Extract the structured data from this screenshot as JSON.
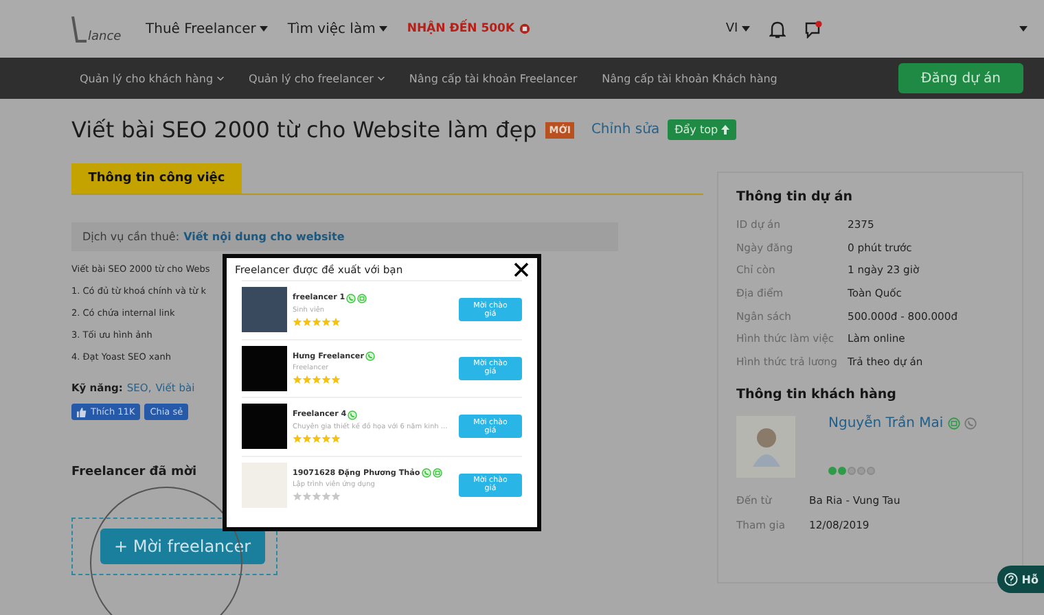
{
  "header": {
    "logo": "lance",
    "menu": [
      {
        "label": "Thuê Freelancer",
        "kind": "dropdown"
      },
      {
        "label": "Tìm việc làm",
        "kind": "dropdown"
      },
      {
        "label": "NHẬN ĐẾN 500K",
        "kind": "promo"
      }
    ],
    "language": "VI",
    "has_notification": true
  },
  "nav": {
    "items": [
      "Quản lý cho khách hàng",
      "Quản lý cho freelancer",
      "Nâng cấp tài khoản Freelancer",
      "Nâng cấp tài khoản Khách hàng"
    ],
    "dropdowns": [
      true,
      true,
      false,
      false
    ],
    "post_button": "Đăng dự án"
  },
  "project": {
    "title": "Viết bài SEO 2000 từ cho Website làm đẹp",
    "new_badge": "MỚI",
    "edit_link": "Chỉnh sửa",
    "top_button": "Đẩy top"
  },
  "tabs": [
    {
      "label": "Thông tin công việc",
      "selected": true
    }
  ],
  "service": {
    "label": "Dịch vụ cần thuê:",
    "value": "Viết nội dung cho website"
  },
  "description": [
    "Viết bài SEO 2000 từ cho Webs",
    "1. Có đủ từ khoá chính và từ k",
    "2. Có chứa internal link",
    "3. Tối ưu hình ảnh",
    "4. Đạt Yoast SEO xanh"
  ],
  "skills": {
    "label": "Kỹ năng:",
    "items": [
      "SEO,",
      "Viết bài"
    ]
  },
  "social": {
    "like": "Thích",
    "like_count": "11K",
    "share": "Chia sẻ"
  },
  "invited": {
    "title": "Freelancer đã mời",
    "button": "+ Mời freelancer"
  },
  "project_info": {
    "title": "Thông tin dự án",
    "rows": [
      {
        "label": "ID dự án",
        "value": "2375"
      },
      {
        "label": "Ngày đăng",
        "value": "0 phút trước"
      },
      {
        "label": "Chỉ còn",
        "value": "1 ngày 23 giờ"
      },
      {
        "label": "Địa điểm",
        "value": "Toàn Quốc"
      },
      {
        "label": "Ngân sách",
        "value": "500.000đ - 800.000đ"
      },
      {
        "label": "Hình thức làm việc",
        "value": "Làm online"
      },
      {
        "label": "Hình thức trả lương",
        "value": "Trả theo dự án"
      }
    ]
  },
  "client_info": {
    "title": "Thông tin khách hàng",
    "name": "Nguyễn Trần Mai",
    "id_verified": true,
    "phone_verified": false,
    "stars": 2,
    "rows": [
      {
        "label": "Đến từ",
        "value": "Ba Ria - Vung Tau"
      },
      {
        "label": "Tham gia",
        "value": "12/08/2019"
      }
    ]
  },
  "help_button": "Hỗ",
  "modal": {
    "title": "Freelancer được đề xuất với bạn",
    "freelancers": [
      {
        "name": "freelancer 1",
        "subtitle": "Sinh viên",
        "phone_verified": true,
        "id_verified": true,
        "stars": 5,
        "kind": "photo",
        "button": "Mời chào giá"
      },
      {
        "name": "Hưng Freelancer",
        "subtitle": "Freelancer",
        "phone_verified": true,
        "id_verified": false,
        "stars": 5,
        "kind": "dark",
        "button": "Mời chào giá"
      },
      {
        "name": "Freelancer 4",
        "subtitle": "Chuyên gia thiết kế đồ họa với 6 năm kinh ...",
        "phone_verified": true,
        "id_verified": false,
        "stars": 5,
        "kind": "dark",
        "button": "Mời chào giá"
      },
      {
        "name": "19071628 Đặng Phương Thảo",
        "subtitle": "Lập trình viên ứng dụng",
        "phone_verified": true,
        "id_verified": true,
        "stars": 0,
        "kind": "light",
        "button": "Mời chào giá"
      }
    ]
  }
}
